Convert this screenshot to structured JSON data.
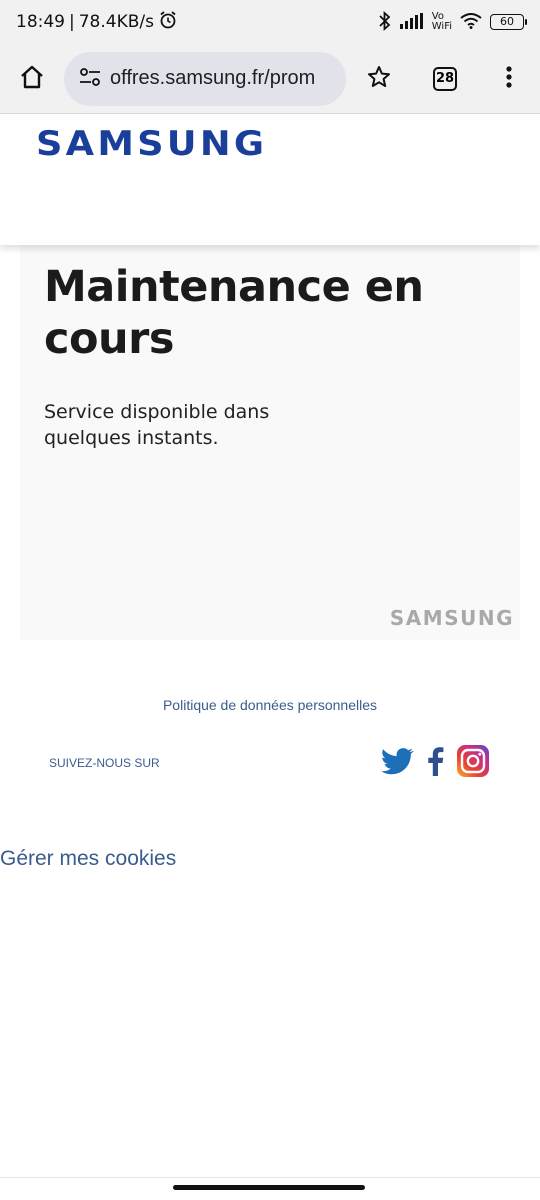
{
  "status_bar": {
    "time": "18:49",
    "separator": "|",
    "network_speed": "78.4KB/s",
    "vo_label": "Vo",
    "wifi_label": "WiFi",
    "battery": "60"
  },
  "browser": {
    "url": "offres.samsung.fr/prom",
    "tab_count": "28"
  },
  "site": {
    "logo_text": "SAMSUNG"
  },
  "card": {
    "title": "Maintenance en cours",
    "subtitle": "Service disponible dans quelques instants.",
    "logo_text": "SAMSUNG"
  },
  "footer": {
    "privacy_link": "Politique de données personnelles",
    "follow_label": "SUIVEZ-NOUS SUR",
    "manage_cookies": "Gérer mes cookies"
  },
  "colors": {
    "brand_blue": "#1a3f9a",
    "link_blue": "#3b5c8e",
    "twitter": "#1d6fb8",
    "facebook": "#2d4f8f"
  }
}
